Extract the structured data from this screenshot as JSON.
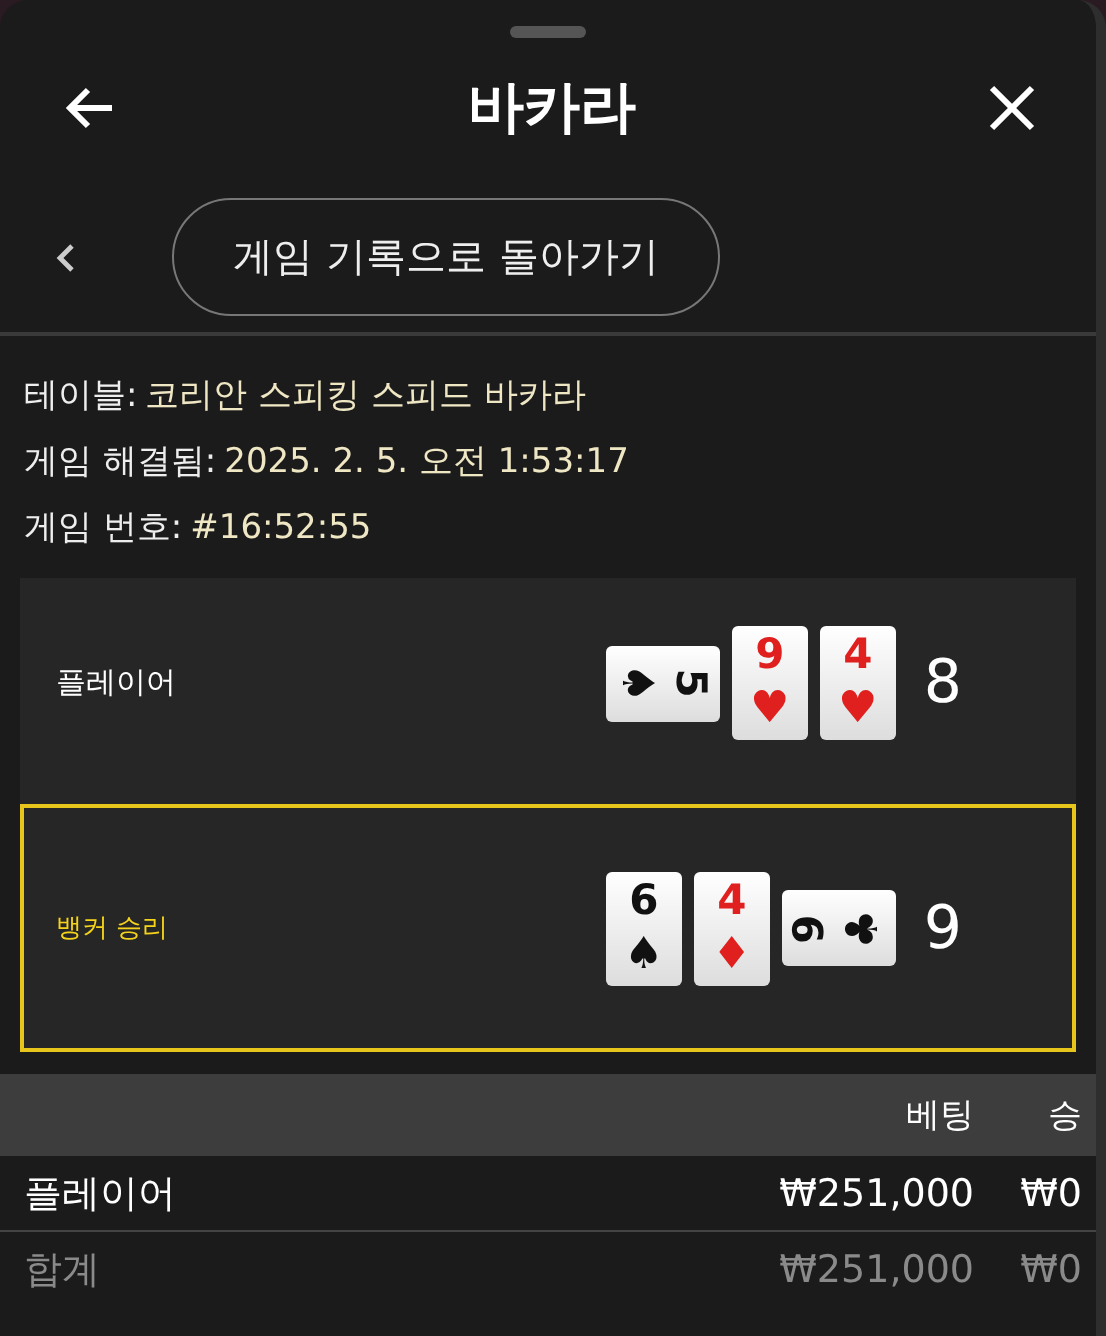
{
  "header": {
    "title": "바카라"
  },
  "back_link": {
    "label": "게임 기록으로 돌아가기"
  },
  "info": [
    {
      "label": "테이블:",
      "value": "코리안 스피킹 스피드 바카라"
    },
    {
      "label": "게임 해결됨:",
      "value": "2025. 2. 5. 오전 1:53:17"
    },
    {
      "label": "게임 번호:",
      "value": "#16:52:55"
    }
  ],
  "hands": [
    {
      "name": "플레이어",
      "won": false,
      "total": "8",
      "cards": [
        {
          "rank": "5",
          "suit": "♠",
          "color": "#111111",
          "kind": "clockwise"
        },
        {
          "rank": "9",
          "suit": "♥",
          "color": "#e0201e",
          "kind": "upright"
        },
        {
          "rank": "4",
          "suit": "♥",
          "color": "#e0201e",
          "kind": "upright"
        }
      ]
    },
    {
      "name": "뱅커 승리",
      "won": true,
      "total": "9",
      "cards": [
        {
          "rank": "6",
          "suit": "♠",
          "color": "#111111",
          "kind": "upright"
        },
        {
          "rank": "4",
          "suit": "♦",
          "color": "#e0201e",
          "kind": "upright"
        },
        {
          "rank": "9",
          "suit": "♣",
          "color": "#111111",
          "kind": "counterclockwise"
        }
      ]
    }
  ],
  "bets": {
    "columns": [
      "베팅",
      "승"
    ],
    "rows": [
      {
        "kind": "bet",
        "label": "플레이어",
        "bet": "₩251,000",
        "win": "₩0"
      },
      {
        "kind": "total",
        "label": "합계",
        "bet": "₩251,000",
        "win": "₩0"
      }
    ]
  }
}
